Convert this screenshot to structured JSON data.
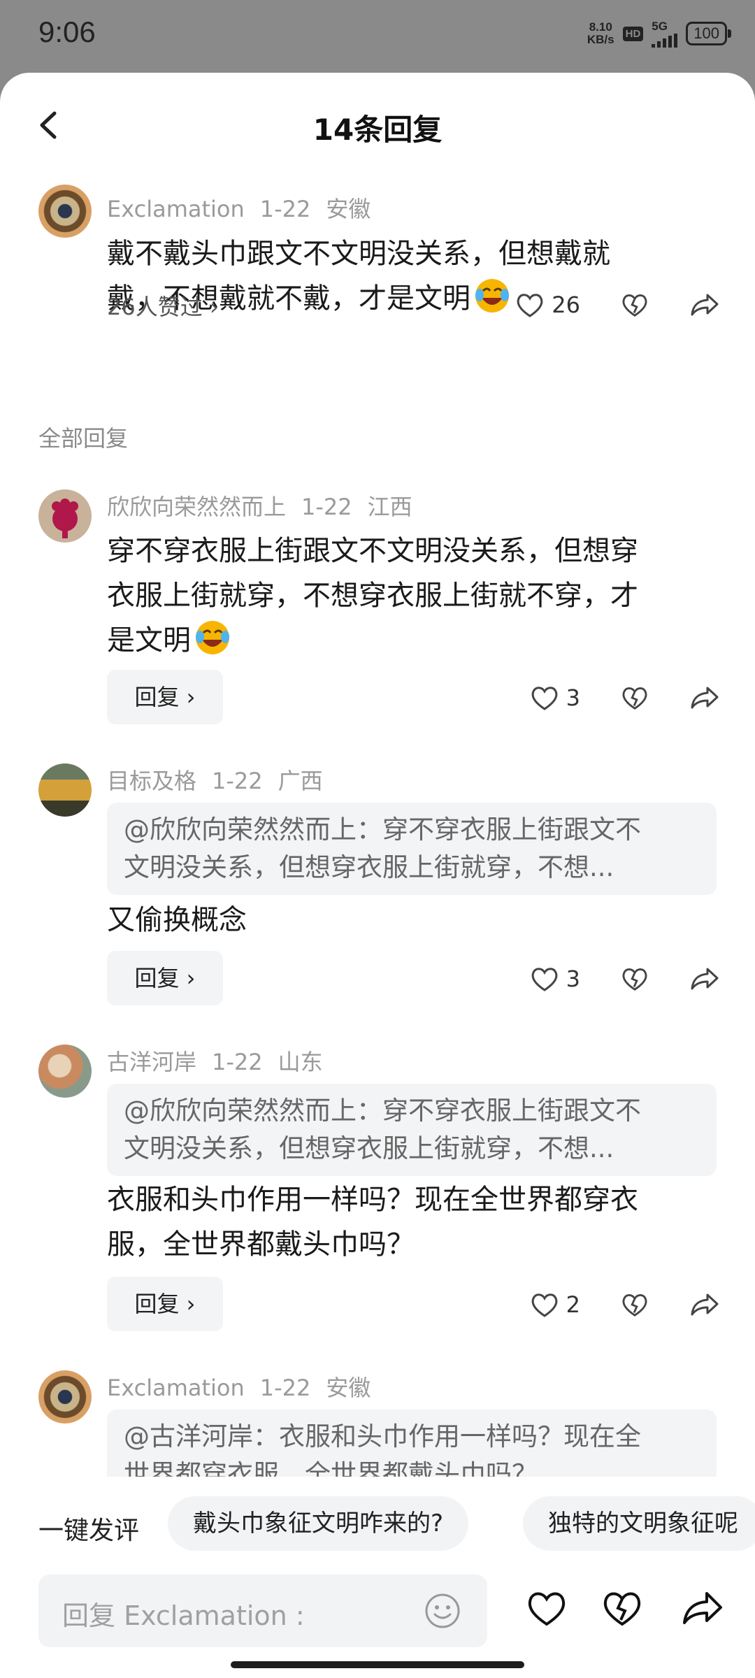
{
  "status": {
    "time": "9:06",
    "net_speed_top": "8.10",
    "net_speed_bottom": "KB/s",
    "hd": "HD",
    "network": "5G",
    "battery": "100"
  },
  "header": {
    "title": "14条回复"
  },
  "main_comment": {
    "author": "Exclamation",
    "date": "1-22",
    "location": "安徽",
    "text_line1": "戴不戴头巾跟文不文明没关系，但想戴就",
    "text_line2": "戴，不想戴就不戴，才是文明",
    "liked_by": "26人赞过 ›",
    "likes": "26"
  },
  "section_label": "全部回复",
  "replies": [
    {
      "author": "欣欣向荣然然而上",
      "date": "1-22",
      "location": "江西",
      "lines": [
        "穿不穿衣服上街跟文不文明没关系，但想穿",
        "衣服上街就穿，不想穿衣服上街就不穿，才",
        "是文明"
      ],
      "likes": "3"
    },
    {
      "author": "目标及格",
      "date": "1-22",
      "location": "广西",
      "quote": [
        "@欣欣向荣然然而上：穿不穿衣服上街跟文不",
        "文明没关系，但想穿衣服上街就穿，不想..."
      ],
      "lines": [
        "又偷换概念"
      ],
      "likes": "3"
    },
    {
      "author": "古洋河岸",
      "date": "1-22",
      "location": "山东",
      "quote": [
        "@欣欣向荣然然而上：穿不穿衣服上街跟文不",
        "文明没关系，但想穿衣服上街就穿，不想..."
      ],
      "lines": [
        "衣服和头巾作用一样吗？现在全世界都穿衣",
        "服，全世界都戴头巾吗？"
      ],
      "likes": "2"
    },
    {
      "author": "Exclamation",
      "date": "1-22",
      "location": "安徽",
      "quote": [
        "@古洋河岸：衣服和头巾作用一样吗？现在全",
        "世界都穿衣服，全世界都戴头巾吗？"
      ]
    }
  ],
  "reply_button_label": "回复 ›",
  "quick_comment": {
    "label": "一键发评",
    "chips": [
      "戴头巾象征文明咋来的?",
      "独特的文明象征呢"
    ]
  },
  "composer": {
    "placeholder": "回复 Exclamation :"
  },
  "colors": {
    "accent_emoji": "#f7b500",
    "bg": "#ffffff",
    "overlay": "#8a8a8a"
  }
}
